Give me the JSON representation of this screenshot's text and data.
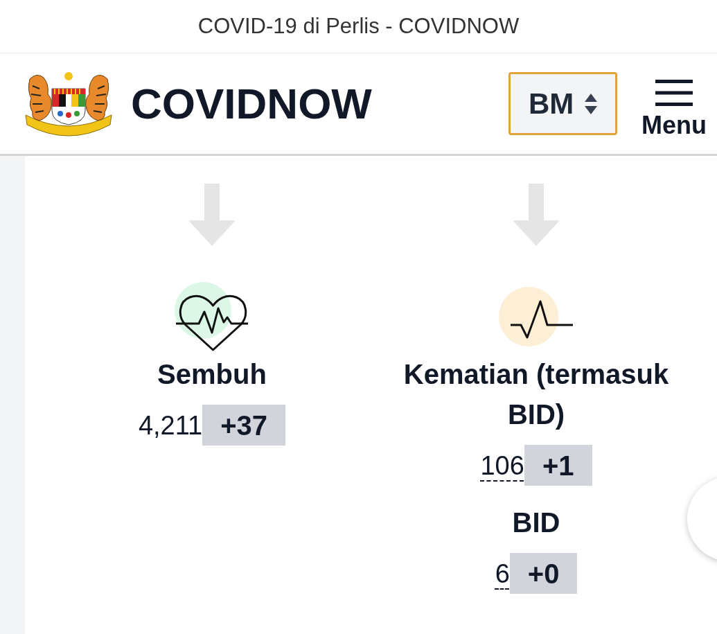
{
  "browser_bar": {
    "title": "COVID-19 di Perlis - COVIDNOW"
  },
  "header": {
    "brand": "COVIDNOW",
    "language_select": {
      "value": "BM",
      "focused": true
    },
    "menu_button": {
      "label": "Menu"
    }
  },
  "columns": [
    {
      "kind": "heart",
      "color": "#dcf7e6",
      "label": "Sembuh",
      "figures": [
        {
          "value": "4,211",
          "change": "+37",
          "dashed_underline": false
        }
      ]
    },
    {
      "kind": "pulse",
      "color": "#fdeed6",
      "label": "Kematian (termasuk BID)",
      "figures": [
        {
          "value": "106",
          "change": "+1",
          "dashed_underline": true
        },
        {
          "label": "BID",
          "value": "6",
          "change": "+0",
          "dashed_underline": true
        }
      ]
    }
  ]
}
